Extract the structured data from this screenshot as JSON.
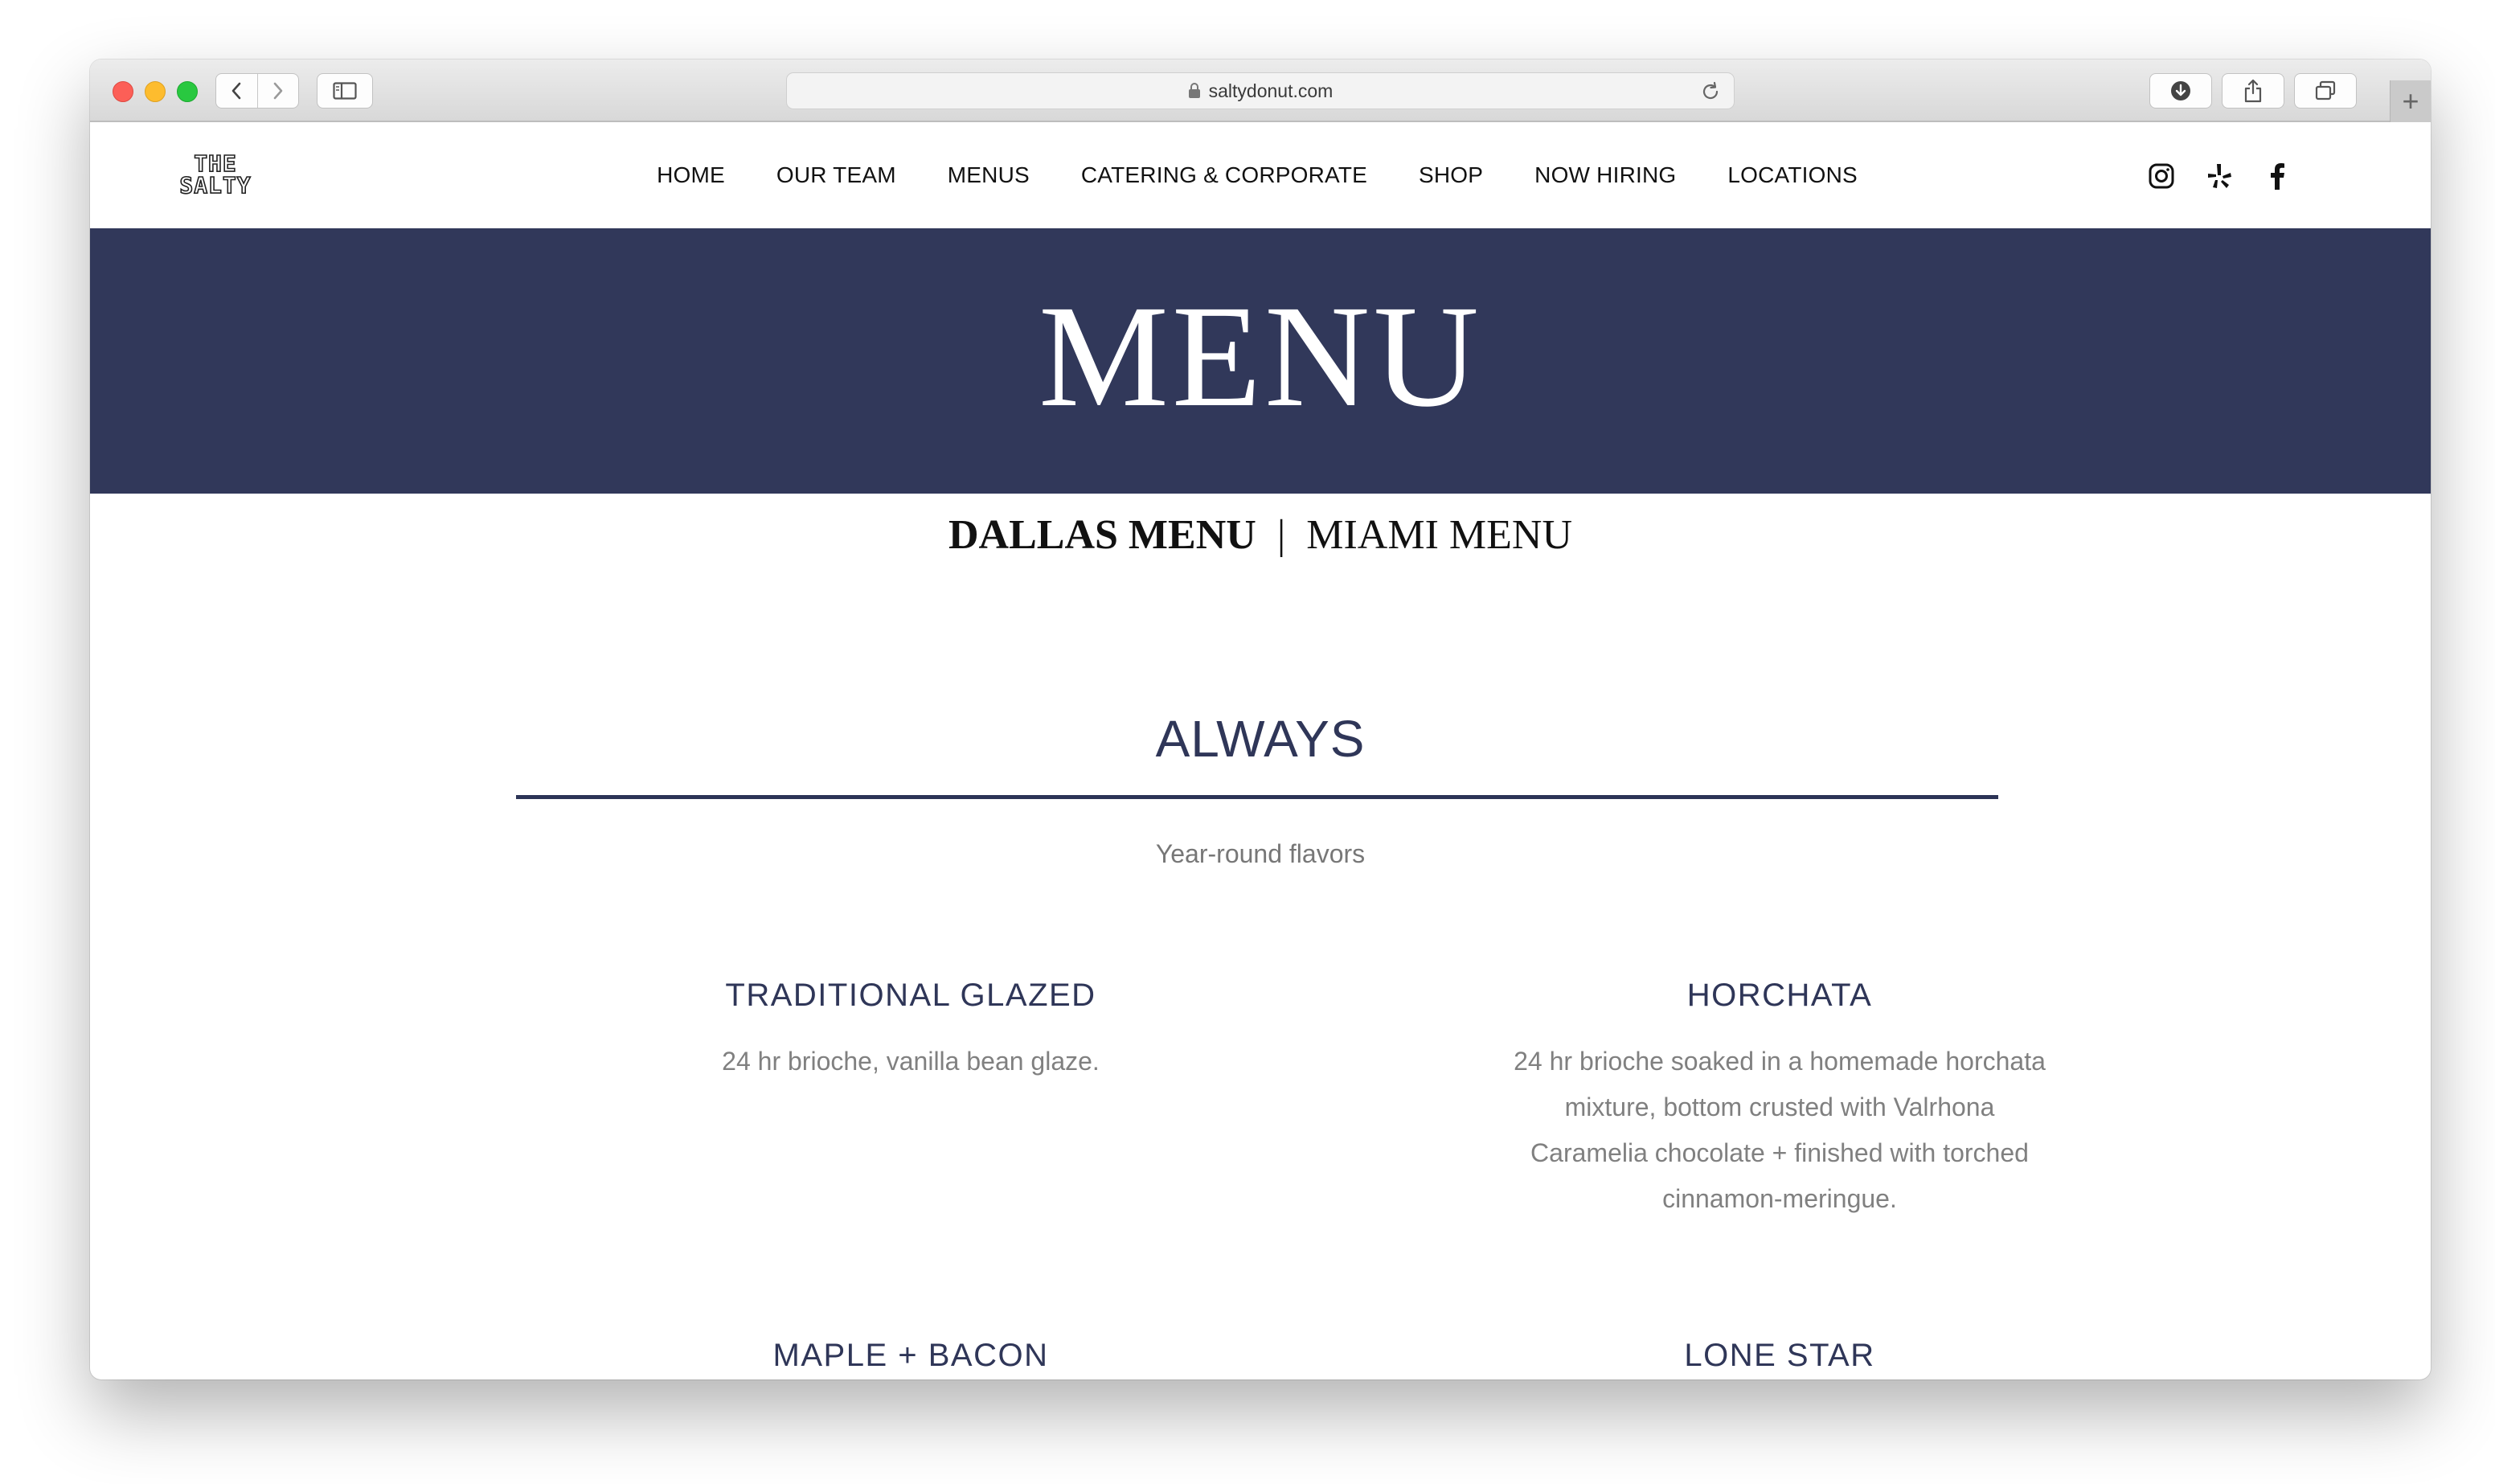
{
  "browser": {
    "url": "saltydonut.com",
    "new_tab_label": "+"
  },
  "site": {
    "logo_line1": "THE",
    "logo_line2": "SALTY",
    "nav": [
      "HOME",
      "OUR TEAM",
      "MENUS",
      "CATERING & CORPORATE",
      "SHOP",
      "NOW HIRING",
      "LOCATIONS"
    ],
    "social_icons": [
      "instagram-icon",
      "yelp-icon",
      "facebook-icon"
    ]
  },
  "hero": {
    "title": "MENU"
  },
  "city_menus": {
    "dallas": "DALLAS MENU",
    "separator": "|",
    "miami": "MIAMI MENU"
  },
  "section": {
    "title": "ALWAYS",
    "subtitle": "Year-round flavors",
    "items": [
      {
        "name": "TRADITIONAL GLAZED",
        "description": "24 hr brioche, vanilla bean glaze."
      },
      {
        "name": "HORCHATA",
        "description": "24 hr brioche soaked in a homemade horchata mixture, bottom crusted with Valrhona Caramelia chocolate + finished with torched cinnamon-meringue."
      },
      {
        "name": "MAPLE + BACON",
        "description": ""
      },
      {
        "name": "LONE STAR",
        "description": ""
      }
    ]
  },
  "colors": {
    "navy": "#31385a",
    "heading_navy": "#2f3658",
    "body_gray": "#808080"
  }
}
